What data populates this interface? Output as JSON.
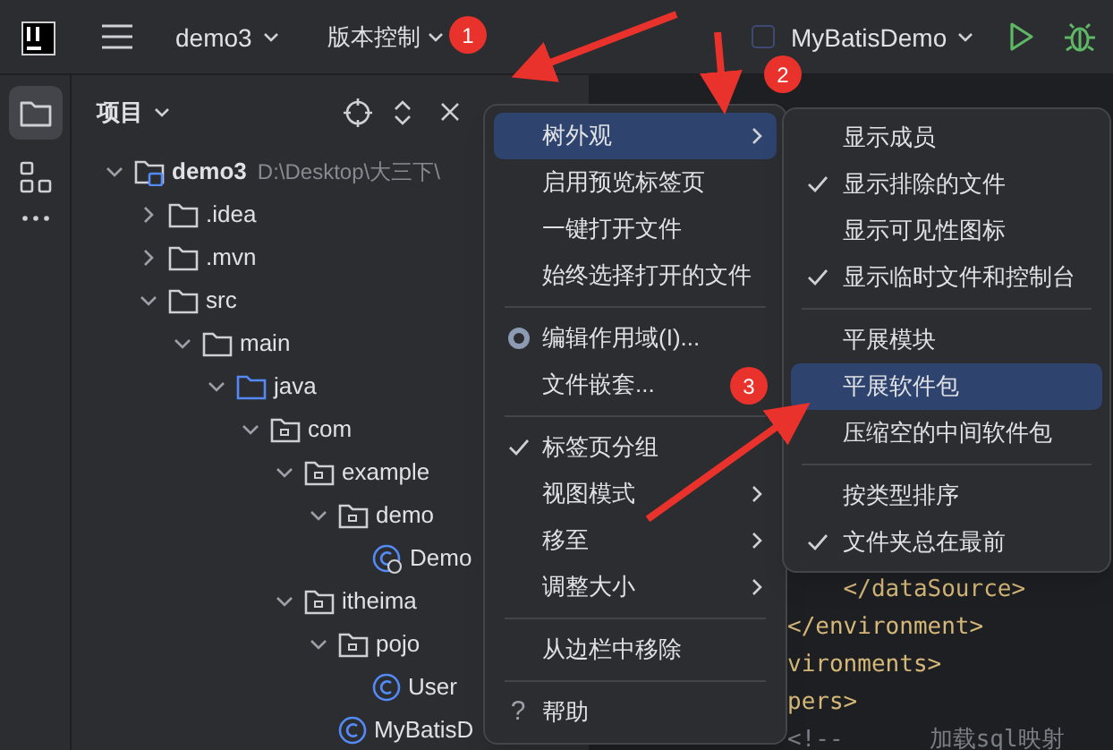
{
  "toolbar": {
    "project": "demo3",
    "vcs": "版本控制",
    "run_config": "MyBatisDemo"
  },
  "panel": {
    "title": "项目"
  },
  "tree": [
    {
      "name": "demo3",
      "path": "D:\\Desktop\\大三下\\",
      "kind": "module",
      "expanded": true,
      "children": [
        {
          "name": ".idea",
          "kind": "folder",
          "expanded": false
        },
        {
          "name": ".mvn",
          "kind": "folder",
          "expanded": false
        },
        {
          "name": "src",
          "kind": "folder",
          "expanded": true,
          "children": [
            {
              "name": "main",
              "kind": "folder",
              "expanded": true,
              "children": [
                {
                  "name": "java",
                  "kind": "source",
                  "expanded": true,
                  "children": [
                    {
                      "name": "com",
                      "kind": "package",
                      "expanded": true,
                      "children": [
                        {
                          "name": "example",
                          "kind": "package",
                          "expanded": true,
                          "children": [
                            {
                              "name": "demo",
                              "kind": "package",
                              "expanded": true,
                              "children": [
                                {
                                  "name": "Demo",
                                  "kind": "runnable-class"
                                }
                              ]
                            }
                          ]
                        },
                        {
                          "name": "itheima",
                          "kind": "package",
                          "expanded": true,
                          "children": [
                            {
                              "name": "pojo",
                              "kind": "package",
                              "expanded": true,
                              "children": [
                                {
                                  "name": "User",
                                  "kind": "class"
                                }
                              ]
                            },
                            {
                              "name": "MyBatisD",
                              "kind": "class"
                            }
                          ]
                        }
                      ]
                    }
                  ]
                }
              ]
            }
          ]
        }
      ]
    }
  ],
  "code_lines": [
    {
      "segments": [
        {
          "text": "    </dataSource>",
          "kind": "tag"
        }
      ]
    },
    {
      "segments": [
        {
          "text": "</environment>",
          "kind": "tag"
        }
      ]
    },
    {
      "segments": [
        {
          "text": "vironments>",
          "kind": "tag"
        }
      ]
    },
    {
      "segments": [
        {
          "text": "pers>",
          "kind": "tag"
        }
      ]
    },
    {
      "segments": [
        {
          "text": "<!--",
          "kind": "comment"
        },
        {
          "text": "加载sql映射",
          "kind": "comment"
        }
      ]
    }
  ],
  "menu": [
    {
      "kind": "item",
      "label": "树外观",
      "selected": true,
      "checked": false,
      "submenu": true
    },
    {
      "kind": "item",
      "label": "启用预览标签页",
      "selected": false,
      "checked": false,
      "submenu": false
    },
    {
      "kind": "item",
      "label": "一键打开文件",
      "selected": false,
      "checked": false,
      "submenu": false
    },
    {
      "kind": "item",
      "label": "始终选择打开的文件",
      "selected": false,
      "checked": false,
      "submenu": false
    },
    {
      "kind": "separator"
    },
    {
      "kind": "radio-item",
      "label": "编辑作用域(I)...",
      "selected": false,
      "checked": true,
      "submenu": false
    },
    {
      "kind": "item",
      "label": "文件嵌套...",
      "selected": false,
      "checked": false,
      "submenu": false
    },
    {
      "kind": "separator"
    },
    {
      "kind": "item",
      "label": "标签页分组",
      "selected": false,
      "checked": true,
      "submenu": false
    },
    {
      "kind": "item",
      "label": "视图模式",
      "selected": false,
      "checked": false,
      "submenu": true
    },
    {
      "kind": "item",
      "label": "移至",
      "selected": false,
      "checked": false,
      "submenu": true
    },
    {
      "kind": "item",
      "label": "调整大小",
      "selected": false,
      "checked": false,
      "submenu": true
    },
    {
      "kind": "separator"
    },
    {
      "kind": "item",
      "label": "从边栏中移除",
      "selected": false,
      "checked": false,
      "submenu": false
    },
    {
      "kind": "separator"
    },
    {
      "kind": "help-item",
      "label": "帮助",
      "icon_text": "?",
      "selected": false,
      "submenu": false
    }
  ],
  "submenu": [
    {
      "kind": "item",
      "label": "显示成员",
      "selected": false,
      "checked": false
    },
    {
      "kind": "item",
      "label": "显示排除的文件",
      "selected": false,
      "checked": true
    },
    {
      "kind": "item",
      "label": "显示可见性图标",
      "selected": false,
      "checked": false
    },
    {
      "kind": "item",
      "label": "显示临时文件和控制台",
      "selected": false,
      "checked": true
    },
    {
      "kind": "separator"
    },
    {
      "kind": "item",
      "label": "平展模块",
      "selected": false,
      "checked": false
    },
    {
      "kind": "item",
      "label": "平展软件包",
      "selected": true,
      "checked": false
    },
    {
      "kind": "item",
      "label": "压缩空的中间软件包",
      "selected": false,
      "checked": false
    },
    {
      "kind": "separator"
    },
    {
      "kind": "item",
      "label": "按类型排序",
      "selected": false,
      "checked": false
    },
    {
      "kind": "item",
      "label": "文件夹总在最前",
      "selected": false,
      "checked": true
    }
  ],
  "annotations": [
    "1",
    "2",
    "3"
  ]
}
